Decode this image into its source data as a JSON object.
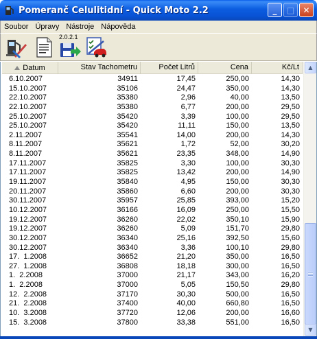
{
  "window": {
    "title": "Pomeranč Celulitidní - Quick Moto 2.2",
    "min_glyph": "_",
    "max_glyph": "□",
    "close_glyph": "✕"
  },
  "menu": [
    "Soubor",
    "Úpravy",
    "Nástroje",
    "Nápověda"
  ],
  "toolbar": {
    "buttons": [
      "fuel-pump-icon",
      "document-icon",
      "save-version-icon",
      "checklist-car-icon"
    ],
    "version_label": "2.0.2.1"
  },
  "table": {
    "columns": [
      "Datum",
      "Stav Tachometru",
      "Počet Litrů",
      "Cena",
      "Kč/Lt"
    ],
    "rows": [
      [
        "6.10.2007",
        "34911",
        "17,45",
        "250,00",
        "14,30"
      ],
      [
        "15.10.2007",
        "35106",
        "24,47",
        "350,00",
        "14,30"
      ],
      [
        "22.10.2007",
        "35380",
        "2,96",
        "40,00",
        "13,50"
      ],
      [
        "22.10.2007",
        "35380",
        "6,77",
        "200,00",
        "29,50"
      ],
      [
        "25.10.2007",
        "35420",
        "3,39",
        "100,00",
        "29,50"
      ],
      [
        "25.10.2007",
        "35420",
        "11,11",
        "150,00",
        "13,50"
      ],
      [
        "2.11.2007",
        "35541",
        "14,00",
        "200,00",
        "14,30"
      ],
      [
        "8.11.2007",
        "35621",
        "1,72",
        "52,00",
        "30,20"
      ],
      [
        "8.11.2007",
        "35621",
        "23,35",
        "348,00",
        "14,90"
      ],
      [
        "17.11.2007",
        "35825",
        "3,30",
        "100,00",
        "30,30"
      ],
      [
        "17.11.2007",
        "35825",
        "13,42",
        "200,00",
        "14,90"
      ],
      [
        "19.11.2007",
        "35840",
        "4,95",
        "150,00",
        "30,30"
      ],
      [
        "20.11.2007",
        "35860",
        "6,60",
        "200,00",
        "30,30"
      ],
      [
        "30.11.2007",
        "35957",
        "25,85",
        "393,00",
        "15,20"
      ],
      [
        "10.12.2007",
        "36166",
        "16,09",
        "250,00",
        "15,50"
      ],
      [
        "19.12.2007",
        "36260",
        "22,02",
        "350,10",
        "15,90"
      ],
      [
        "19.12.2007",
        "36260",
        "5,09",
        "151,70",
        "29,80"
      ],
      [
        "30.12.2007",
        "36340",
        "25,16",
        "392,50",
        "15,60"
      ],
      [
        "30.12.2007",
        "36340",
        "3,36",
        "100,10",
        "29,80"
      ],
      [
        "17.  1.2008",
        "36652",
        "21,20",
        "350,00",
        "16,50"
      ],
      [
        "27.  1.2008",
        "36808",
        "18,18",
        "300,00",
        "16,50"
      ],
      [
        "1.  2.2008",
        "37000",
        "21,17",
        "343,00",
        "16,20"
      ],
      [
        "1.  2.2008",
        "37000",
        "5,05",
        "150,50",
        "29,80"
      ],
      [
        "12.  2.2008",
        "37170",
        "30,30",
        "500,00",
        "16,50"
      ],
      [
        "21.  2.2008",
        "37400",
        "40,00",
        "660,80",
        "16,50"
      ],
      [
        "10.  3.2008",
        "37720",
        "12,06",
        "200,00",
        "16,60"
      ],
      [
        "15.  3.2008",
        "37800",
        "33,38",
        "551,00",
        "16,50"
      ]
    ]
  },
  "scrollbar": {
    "up_glyph": "▲",
    "down_glyph": "▼"
  }
}
